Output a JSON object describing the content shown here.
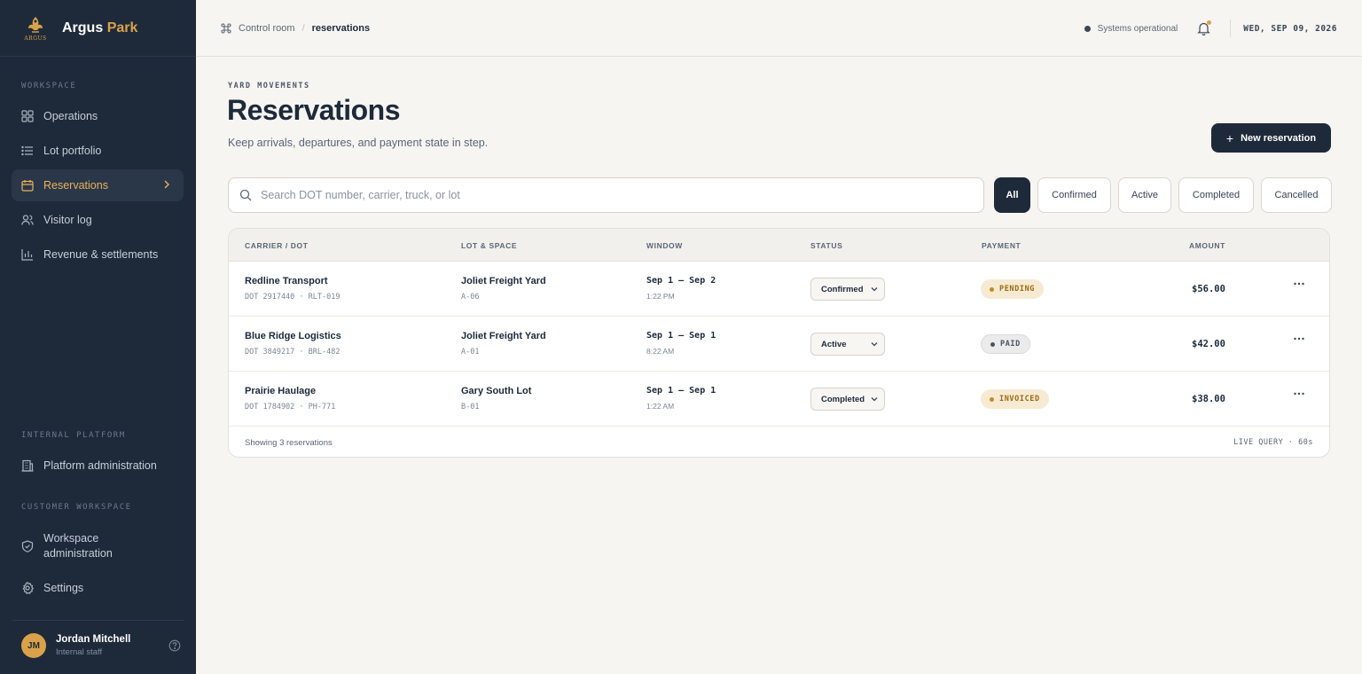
{
  "brand": {
    "name_main": "Argus",
    "name_accent": "Park",
    "logo_text": "ARGUS"
  },
  "sidebar": {
    "workspace_label": "WORKSPACE",
    "items": [
      {
        "label": "Operations",
        "icon": "grid-icon"
      },
      {
        "label": "Lot portfolio",
        "icon": "list-icon"
      },
      {
        "label": "Reservations",
        "icon": "calendar-icon",
        "active": true
      },
      {
        "label": "Visitor log",
        "icon": "users-icon"
      },
      {
        "label": "Revenue & settlements",
        "icon": "bar-chart-icon"
      }
    ],
    "internal_label": "INTERNAL PLATFORM",
    "platform_admin": "Platform administration",
    "customer_label": "CUSTOMER WORKSPACE",
    "workspace_admin_line1": "Workspace",
    "workspace_admin_line2": "administration",
    "settings": "Settings",
    "user": {
      "initials": "JM",
      "name": "Jordan Mitchell",
      "role": "Internal staff"
    }
  },
  "topbar": {
    "breadcrumb_root": "Control room",
    "breadcrumb_sep": "/",
    "breadcrumb_current": "reservations",
    "status": "Systems operational",
    "date": "WED, SEP 09, 2026"
  },
  "page": {
    "eyebrow": "YARD MOVEMENTS",
    "title": "Reservations",
    "subtitle": "Keep arrivals, departures, and payment state in step.",
    "new_button": "New reservation",
    "new_button_plus": "+"
  },
  "search": {
    "placeholder": "Search DOT number, carrier, truck, or lot",
    "value": ""
  },
  "filters": [
    "All",
    "Confirmed",
    "Active",
    "Completed",
    "Cancelled"
  ],
  "table": {
    "headers": [
      "CARRIER / DOT",
      "LOT & SPACE",
      "WINDOW",
      "STATUS",
      "PAYMENT",
      "AMOUNT"
    ],
    "rows": [
      {
        "carrier": "Redline Transport",
        "dot": "DOT 2917440 · RLT-019",
        "lot": "Joliet Freight Yard",
        "space": "A-06",
        "window": "Sep 1 – Sep 2",
        "time": "1:22 PM",
        "status": "Confirmed",
        "payment": "PENDING",
        "amount": "$56.00"
      },
      {
        "carrier": "Blue Ridge Logistics",
        "dot": "DOT 3849217 · BRL-482",
        "lot": "Joliet Freight Yard",
        "space": "A-01",
        "window": "Sep 1 – Sep 1",
        "time": "8:22 AM",
        "status": "Active",
        "payment": "PAID",
        "amount": "$42.00"
      },
      {
        "carrier": "Prairie Haulage",
        "dot": "DOT 1784902 · PH-771",
        "lot": "Gary South Lot",
        "space": "B-01",
        "window": "Sep 1 – Sep 1",
        "time": "1:22 AM",
        "status": "Completed",
        "payment": "INVOICED",
        "amount": "$38.00"
      }
    ],
    "footer_left": "Showing 3 reservations",
    "footer_right": "LIVE QUERY · 60s"
  },
  "colors": {
    "sidebar_bg": "#1e2a3a",
    "accent": "#d9a24a",
    "pending_bg": "#f6ead2",
    "pending_fg": "#9a6a12",
    "paid_bg": "#ebebeb",
    "paid_fg": "#4a5360",
    "invoiced_bg": "#f6ead2",
    "invoiced_fg": "#9a6a12"
  }
}
